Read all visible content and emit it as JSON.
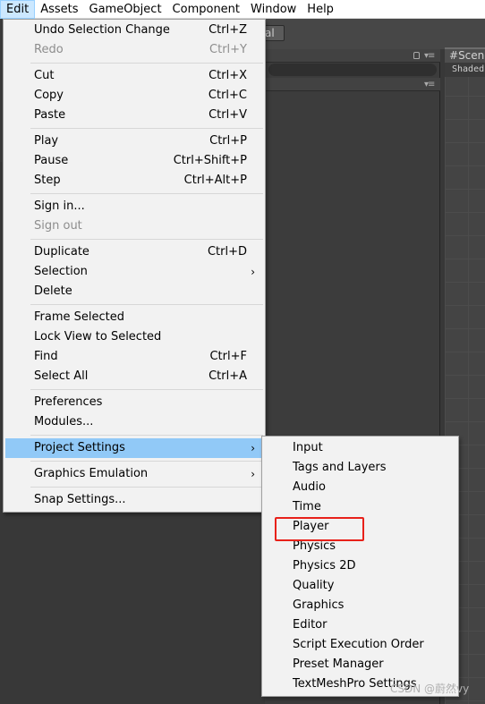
{
  "menubar": {
    "items": [
      {
        "label": "Edit",
        "active": true
      },
      {
        "label": "Assets"
      },
      {
        "label": "GameObject"
      },
      {
        "label": "Component"
      },
      {
        "label": "Window"
      },
      {
        "label": "Help"
      }
    ]
  },
  "background": {
    "toolbar_button_label": "al",
    "scene_tab_label": "Scene",
    "scene_shading_label": "Shaded"
  },
  "edit_menu": {
    "undo": {
      "label": "Undo Selection Change",
      "shortcut": "Ctrl+Z"
    },
    "redo": {
      "label": "Redo",
      "shortcut": "Ctrl+Y"
    },
    "cut": {
      "label": "Cut",
      "shortcut": "Ctrl+X"
    },
    "copy": {
      "label": "Copy",
      "shortcut": "Ctrl+C"
    },
    "paste": {
      "label": "Paste",
      "shortcut": "Ctrl+V"
    },
    "play": {
      "label": "Play",
      "shortcut": "Ctrl+P"
    },
    "pause": {
      "label": "Pause",
      "shortcut": "Ctrl+Shift+P"
    },
    "step": {
      "label": "Step",
      "shortcut": "Ctrl+Alt+P"
    },
    "sign_in": {
      "label": "Sign in..."
    },
    "sign_out": {
      "label": "Sign out"
    },
    "duplicate": {
      "label": "Duplicate",
      "shortcut": "Ctrl+D"
    },
    "selection": {
      "label": "Selection"
    },
    "delete": {
      "label": "Delete"
    },
    "frame_selected": {
      "label": "Frame Selected"
    },
    "lock_view": {
      "label": "Lock View to Selected"
    },
    "find": {
      "label": "Find",
      "shortcut": "Ctrl+F"
    },
    "select_all": {
      "label": "Select All",
      "shortcut": "Ctrl+A"
    },
    "preferences": {
      "label": "Preferences"
    },
    "modules": {
      "label": "Modules..."
    },
    "project_settings": {
      "label": "Project Settings"
    },
    "graphics_emulation": {
      "label": "Graphics Emulation"
    },
    "snap_settings": {
      "label": "Snap Settings..."
    },
    "submenu_arrow": "›"
  },
  "project_settings_submenu": {
    "items": [
      "Input",
      "Tags and Layers",
      "Audio",
      "Time",
      "Player",
      "Physics",
      "Physics 2D",
      "Quality",
      "Graphics",
      "Editor",
      "Script Execution Order",
      "Preset Manager",
      "TextMeshPro Settings"
    ]
  },
  "watermark": "CSDN @蔚然vy",
  "colors": {
    "highlight": "#91c9f7",
    "annotation_box": "#e8211a",
    "menu_background": "#f2f2f2"
  }
}
